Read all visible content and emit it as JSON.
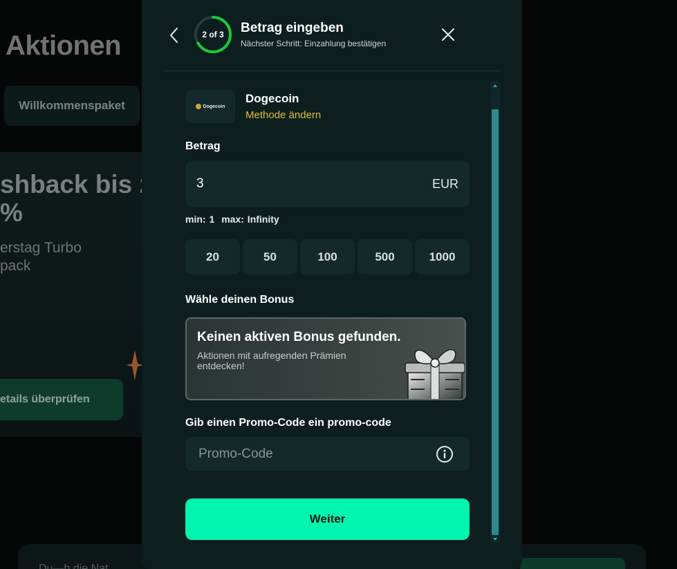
{
  "background": {
    "page_title": "Aktionen",
    "tab_label": "Willkommenspaket",
    "card_title": "shback bis z\n%",
    "card_subtitle": "erstag Turbo\npack",
    "card_button": "etails überprüfen",
    "footer_text": "Du—h die Nat"
  },
  "modal": {
    "header": {
      "step_label": "2 of 3",
      "step_progress": 0.667,
      "title": "Betrag eingeben",
      "subtitle": "Nächster Schritt: Einzahlung bestätigen",
      "back_icon": "chevron-left-icon",
      "close_icon": "close-icon"
    },
    "method": {
      "logo_text": "Dogecoin",
      "name": "Dogecoin",
      "change_link": "Methode ändern"
    },
    "amount": {
      "label": "Betrag",
      "value": "3",
      "currency": "EUR",
      "min_label": "min: 1",
      "max_label": "max: Infinity",
      "quick_amounts": [
        "20",
        "50",
        "100",
        "500",
        "1000"
      ]
    },
    "bonus": {
      "label": "Wähle deinen Bonus",
      "title": "Keinen aktiven Bonus gefunden.",
      "subtitle": "Aktionen mit aufregenden Prämien entdecken!"
    },
    "promo": {
      "label": "Gib einen Promo-Code ein promo-code",
      "placeholder": "Promo-Code",
      "info_icon": "info-icon"
    },
    "submit_label": "Weiter"
  },
  "colors": {
    "accent": "#00f5ae",
    "link": "#e0bf32",
    "progress": "#19c93b",
    "modal_bg": "#0d1e1e"
  }
}
